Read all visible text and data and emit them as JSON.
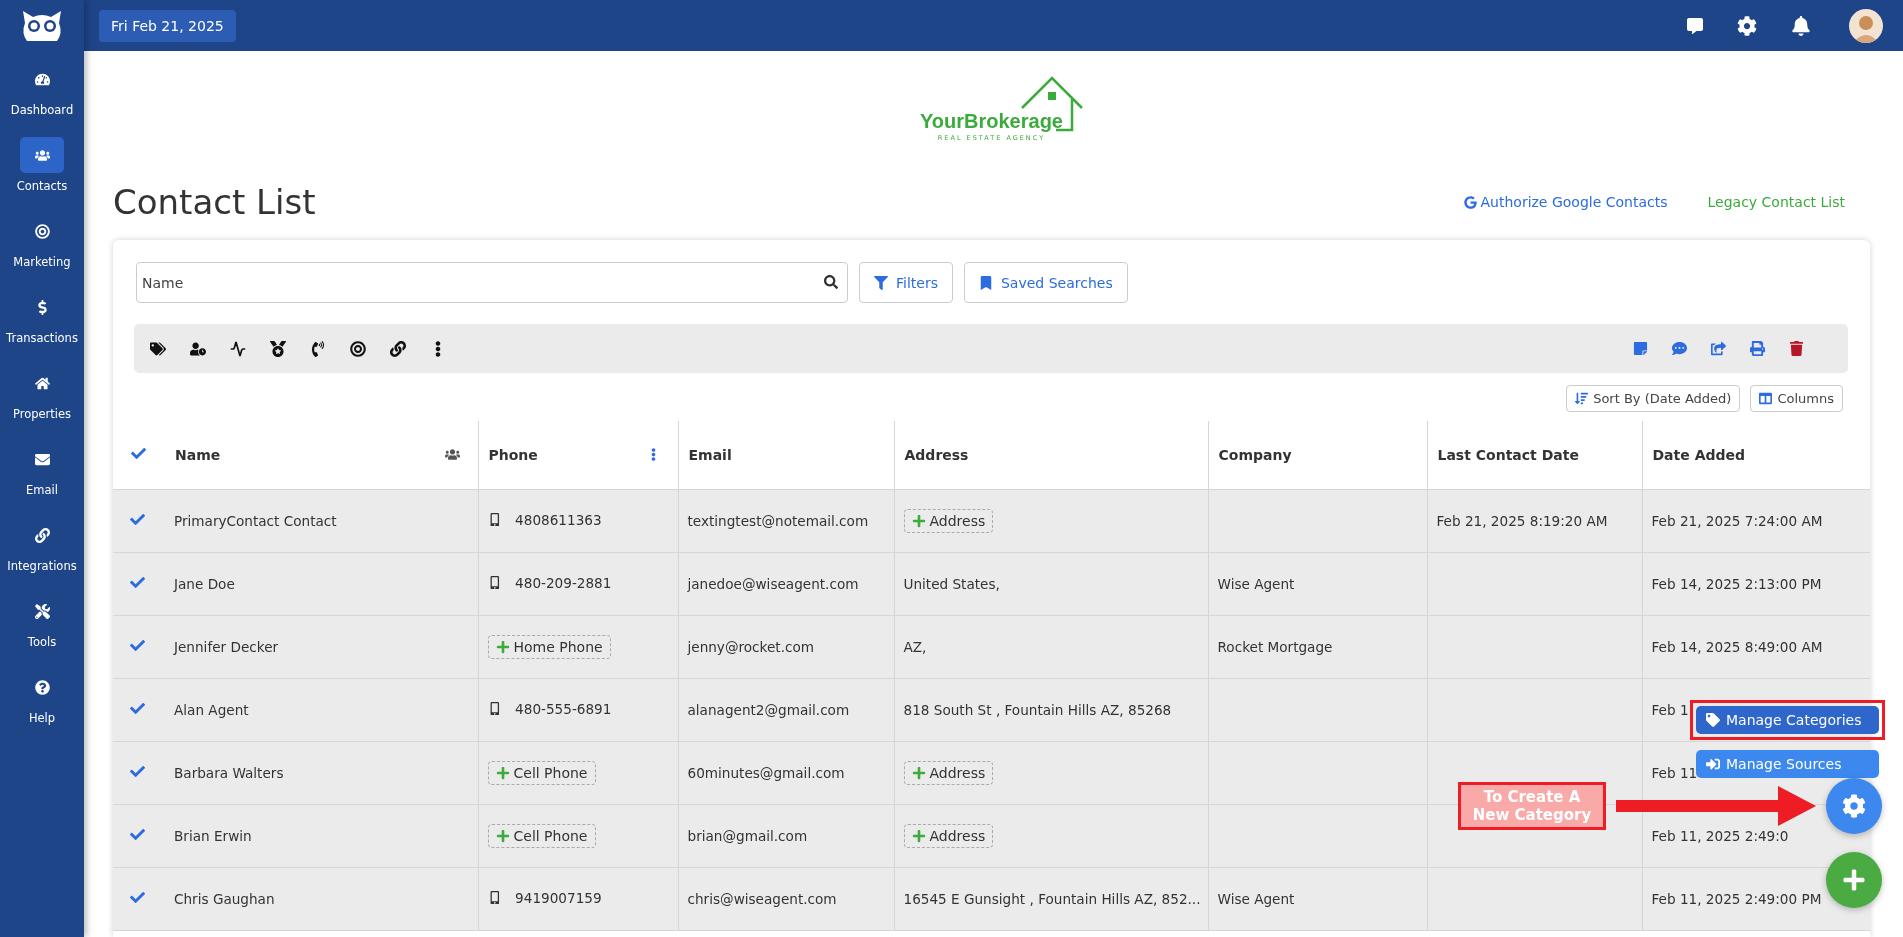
{
  "sidebar": {
    "items": [
      {
        "label": "Dashboard",
        "selected": false
      },
      {
        "label": "Contacts",
        "selected": true
      },
      {
        "label": "Marketing",
        "selected": false
      },
      {
        "label": "Transactions",
        "selected": false
      },
      {
        "label": "Properties",
        "selected": false
      },
      {
        "label": "Email",
        "selected": false
      },
      {
        "label": "Integrations",
        "selected": false
      },
      {
        "label": "Tools",
        "selected": false
      },
      {
        "label": "Help",
        "selected": false
      }
    ]
  },
  "topbar": {
    "date": "Fri Feb 21, 2025"
  },
  "brand": {
    "name": "YourBrokerage",
    "tagline": "REAL ESTATE AGENCY"
  },
  "page": {
    "title": "Contact List",
    "links": [
      {
        "label": "Authorize Google Contacts",
        "kind": "google"
      },
      {
        "label": "Legacy Contact List",
        "kind": "legacy"
      }
    ]
  },
  "search": {
    "placeholder": "Name"
  },
  "filter_buttons": [
    "Filters",
    "Saved Searches"
  ],
  "sort_buttons": [
    "Sort By (Date Added)",
    "Columns"
  ],
  "table": {
    "all_checked": true,
    "columns": [
      "Name",
      "Phone",
      "Email",
      "Address",
      "Company",
      "Last Contact Date",
      "Date Added"
    ],
    "rows": [
      {
        "checked": true,
        "name": "PrimaryContact Contact",
        "phone": {
          "kind": "number",
          "text": "4808611363"
        },
        "email": "textingtest@notemail.com",
        "address": {
          "kind": "add",
          "text": "Address"
        },
        "last_contact": "Feb 21, 2025 8:19:20 AM",
        "date_added": "Feb 21, 2025 7:24:00 AM"
      },
      {
        "checked": true,
        "name": "Jane Doe",
        "phone": {
          "kind": "number",
          "text": "480-209-2881"
        },
        "email": "janedoe@wiseagent.com",
        "address": {
          "kind": "text",
          "text": "United States,"
        },
        "company": "Wise Agent",
        "date_added": "Feb 14, 2025 2:13:00 PM"
      },
      {
        "checked": true,
        "name": "Jennifer Decker",
        "phone": {
          "kind": "add",
          "text": "Home Phone"
        },
        "email": "jenny@rocket.com",
        "address": {
          "kind": "text",
          "text": "AZ,"
        },
        "company": "Rocket Mortgage",
        "date_added": "Feb 14, 2025 8:49:00 AM"
      },
      {
        "checked": true,
        "name": "Alan Agent",
        "phone": {
          "kind": "number",
          "text": "480-555-6891"
        },
        "email": "alanagent2@gmail.com",
        "address": {
          "kind": "text",
          "text": "818 South St , Fountain Hills AZ, 85268"
        },
        "date_added": "Feb 1"
      },
      {
        "checked": true,
        "name": "Barbara Walters",
        "phone": {
          "kind": "add",
          "text": "Cell Phone"
        },
        "email": "60minutes@gmail.com",
        "address": {
          "kind": "add",
          "text": "Address"
        },
        "date_added": "Feb 11"
      },
      {
        "checked": true,
        "name": "Brian Erwin",
        "phone": {
          "kind": "add",
          "text": "Cell Phone"
        },
        "email": "brian@gmail.com",
        "address": {
          "kind": "add",
          "text": "Address"
        },
        "date_added": "Feb 11, 2025 2:49:0"
      },
      {
        "checked": true,
        "name": "Chris Gaughan",
        "phone": {
          "kind": "number",
          "text": "9419007159"
        },
        "email": "chris@wiseagent.com",
        "address": {
          "kind": "text",
          "text": "16545 E Gunsight , Fountain Hills AZ, 852..."
        },
        "company": "Wise Agent",
        "date_added": "Feb 11, 2025 2:49:00 PM"
      }
    ]
  },
  "fab_menu": [
    {
      "label": "Manage Categories",
      "highlighted": true
    },
    {
      "label": "Manage Sources",
      "highlighted": false
    }
  ],
  "annotation": {
    "text": "To Create A New Category"
  }
}
